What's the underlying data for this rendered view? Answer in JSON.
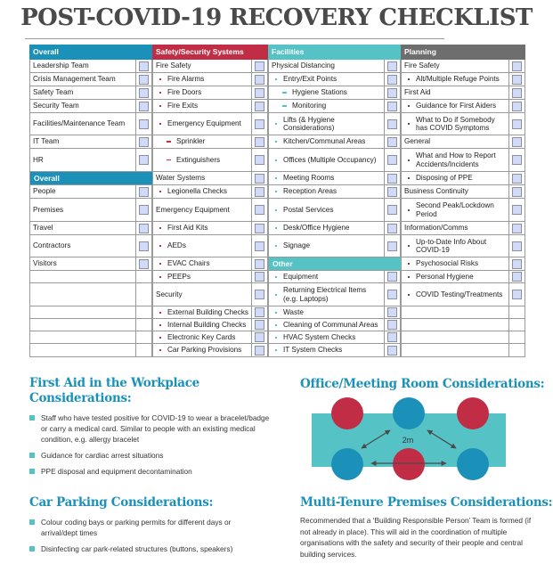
{
  "title": "POST-COVID-19 RECOVERY CHECKLIST",
  "colors": {
    "blue": "#1b91b9",
    "red": "#c12d44",
    "teal": "#55c2c6",
    "gray": "#6e6e6e",
    "checkbox": "#d1dbf7"
  },
  "checklist": {
    "overall": {
      "header": "Overall",
      "items": [
        "Leadership Team",
        "Crisis Management Team",
        "Safety Team",
        "Security Team",
        "Facilities/Maintenance Team",
        "IT Team",
        "HR"
      ],
      "sub_header": "Overall",
      "sub_items": [
        "People",
        "Premises",
        "Travel",
        "Contractors",
        "Visitors"
      ]
    },
    "safety": {
      "header": "Safety/Security Systems",
      "items": [
        "Fire Safety",
        "Fire Alarms",
        "Fire Doors",
        "Fire Exits",
        "Emergency Equipment",
        "Sprinkler",
        "Extinguishers",
        "Water Systems",
        "Legionella Checks",
        "Emergency Equipment",
        "First Aid Kits",
        "AEDs",
        "EVAC Chairs",
        "PEEPs",
        "Security",
        "External Building Checks",
        "Internal Building Checks",
        "Electronic Key Cards",
        "Car Parking Provisions"
      ]
    },
    "facilities": {
      "header": "Facilities",
      "items": [
        "Physical Distancing",
        "Entry/Exit Points",
        "Hygiene Stations",
        "Monitoring",
        "Lifts (& Hygiene Considerations)",
        "Kitchen/Communal Areas",
        "Offices (Multiple Occupancy)",
        "Meeting Rooms",
        "Reception Areas",
        "Postal Services",
        "Desk/Office Hygiene",
        "Signage"
      ],
      "sub_header": "Other",
      "sub_items": [
        "Equipment",
        "Returning Electrical Items (e.g. Laptops)",
        "Waste",
        "Cleaning of Communal Areas",
        "HVAC System Checks",
        "IT System Checks"
      ]
    },
    "planning": {
      "header": "Planning",
      "items": [
        "Fire Safety",
        "Alt/Multiple Refuge Points",
        "First Aid",
        "Guidance for First Aiders",
        "What to Do if Somebody has COVID Symptoms",
        "General",
        "What and How to Report Accidents/Incidents",
        "Disposing of PPE",
        "Business Continuity",
        "Second Peak/Lockdown Period",
        "Information/Comms",
        "Up-to-Date Info About COVID-19",
        "Psychosocial Risks",
        "Personal Hygiene",
        "COVID Testing/Treatments"
      ]
    }
  },
  "first_aid": {
    "title_line1": "First Aid in the Workplace",
    "title_line2": "Considerations:",
    "bullets": [
      "Staff who have tested positive for COVID-19 to wear a bracelet/badge or carry a medical card. Similar to people with an existing medical condition, e.g. allergy bracelet",
      "Guidance for cardiac arrest situations",
      "PPE disposal and equipment decontamination"
    ]
  },
  "car_parking": {
    "title": "Car Parking Considerations:",
    "bullets": [
      "Colour coding bays or parking permits for different days or arrival/dept times",
      "Disinfecting car park-related structures (buttons, speakers)"
    ]
  },
  "office": {
    "title": "Office/Meeting Room Considerations:",
    "distance_label": "2m"
  },
  "multi_tenure": {
    "title": "Multi-Tenure Premises Considerations:",
    "text": "Recommended that a ‘Building Responsible Person’ Team is formed (if not already in place). This will aid in the coordination of multiple organisations with the safety and security of their people and central building services."
  }
}
